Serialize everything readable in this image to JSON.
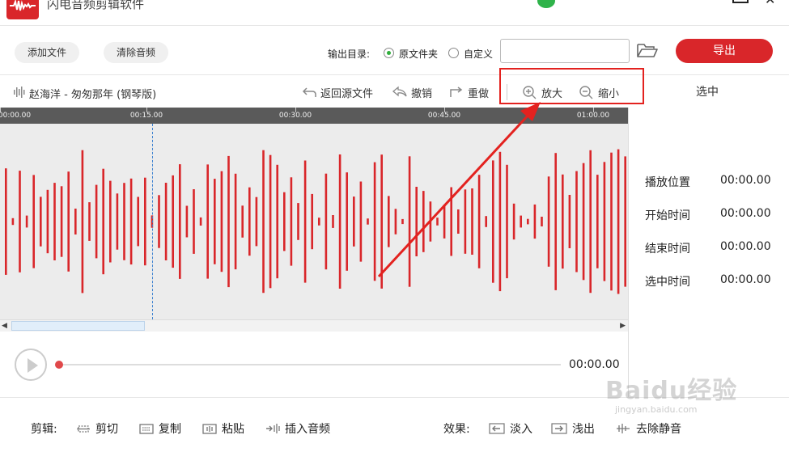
{
  "window": {
    "title": "闪电音频剪辑软件",
    "close_glyph": "✕"
  },
  "toolbar": {
    "add_file": "添加文件",
    "clear_audio": "清除音频",
    "output_label": "输出目录:",
    "radio_original": "原文件夹",
    "radio_custom": "自定义",
    "output_path_value": "",
    "export": "导出"
  },
  "edit_bar": {
    "track_name": "赵海洋 - 匆匆那年 (钢琴版)",
    "back_to_source": "返回源文件",
    "undo": "撤销",
    "redo": "重做",
    "zoom_in": "放大",
    "zoom_out": "缩小",
    "selection_title": "选中"
  },
  "timeline": {
    "ticks": [
      "00:00.00",
      "00:15.00",
      "00:30.00",
      "00:45.00",
      "01:00.00"
    ]
  },
  "selection_info": [
    {
      "label": "播放位置",
      "value": "00:00.00"
    },
    {
      "label": "开始时间",
      "value": "00:00.00"
    },
    {
      "label": "结束时间",
      "value": "00:00.00"
    },
    {
      "label": "选中时间",
      "value": "00:00.00"
    }
  ],
  "player": {
    "time": "00:00.00",
    "progress": 0
  },
  "bottom_bar": {
    "edit_label": "剪辑:",
    "cut": "剪切",
    "copy": "复制",
    "paste": "粘贴",
    "insert_audio": "插入音频",
    "effects_label": "效果:",
    "fade_in": "淡入",
    "fade_out": "浅出",
    "remove_silence": "去除静音"
  },
  "watermark": {
    "text": "Baidu经验",
    "sub": "jingyan.baidu.com"
  },
  "colors": {
    "accent": "#d9262a",
    "waveform": "#d9262a",
    "radio_on": "#2fae3c",
    "highlight": "#e3221f"
  }
}
